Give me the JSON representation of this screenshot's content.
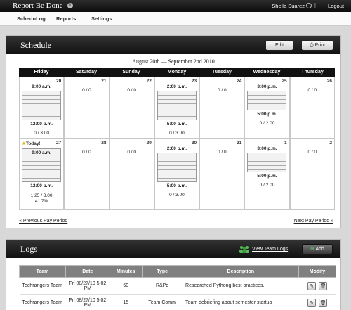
{
  "app": {
    "title": "Report Be Done",
    "info_icon": "i",
    "user": "Sheila Suarez",
    "separator": "|",
    "logout": "Logout"
  },
  "nav": {
    "items": [
      "ScheduLog",
      "Reports",
      "Settings"
    ]
  },
  "schedule": {
    "title": "Schedule",
    "edit_label": "Edit",
    "print_label": "Print",
    "range_label": "August 20th — September 2nd 2010",
    "days": [
      "Friday",
      "Saturday",
      "Sunday",
      "Monday",
      "Tuesday",
      "Wednesday",
      "Thursday"
    ],
    "weeks": [
      [
        {
          "day": "20",
          "start": "9:00 a.m.",
          "end": "12:00 p.m.",
          "summary": "0 / 3.00"
        },
        {
          "day": "21",
          "summary": "0 / 0"
        },
        {
          "day": "22",
          "summary": "0 / 0"
        },
        {
          "day": "23",
          "start": "2:00 p.m.",
          "end": "5:00 p.m.",
          "summary": "0 / 3.00"
        },
        {
          "day": "24",
          "summary": "0 / 0"
        },
        {
          "day": "25",
          "start": "3:00 p.m.",
          "end": "5:00 p.m.",
          "summary": "0 / 2.00"
        },
        {
          "day": "26",
          "summary": "0 / 0"
        }
      ],
      [
        {
          "day": "27",
          "today": "Today!",
          "start": "9:00 a.m.",
          "end": "12:00 p.m.",
          "summary": "1.25 / 3.00",
          "percent": "41.7%"
        },
        {
          "day": "28",
          "summary": "0 / 0"
        },
        {
          "day": "29",
          "summary": "0 / 0"
        },
        {
          "day": "30",
          "start": "2:00 p.m.",
          "end": "5:00 p.m.",
          "summary": "0 / 3.00"
        },
        {
          "day": "31",
          "summary": "0 / 0"
        },
        {
          "day": "1",
          "start": "3:00 p.m.",
          "end": "5:00 p.m.",
          "summary": "0 / 2.00"
        },
        {
          "day": "2",
          "summary": "0 / 0"
        }
      ]
    ],
    "prev_label": "« Previous Pay Period",
    "next_label": "Next Pay Period »"
  },
  "logs": {
    "title": "Logs",
    "team_logs_label": "View Team Logs",
    "add_label": "Add",
    "columns": [
      "Team",
      "Date",
      "Minutes",
      "Type",
      "Description",
      "Modify"
    ],
    "rows": [
      {
        "team": "Techrangers Team",
        "date": "Fri 08/27/10 5:02 PM",
        "minutes": "60",
        "type": "R&Pd",
        "description": "Researched Pythong best practices."
      },
      {
        "team": "Techrangers Team",
        "date": "Fri 08/27/10 5:02 PM",
        "minutes": "15",
        "type": "Team Comm",
        "description": "Team debriefing about semester startup"
      }
    ]
  }
}
